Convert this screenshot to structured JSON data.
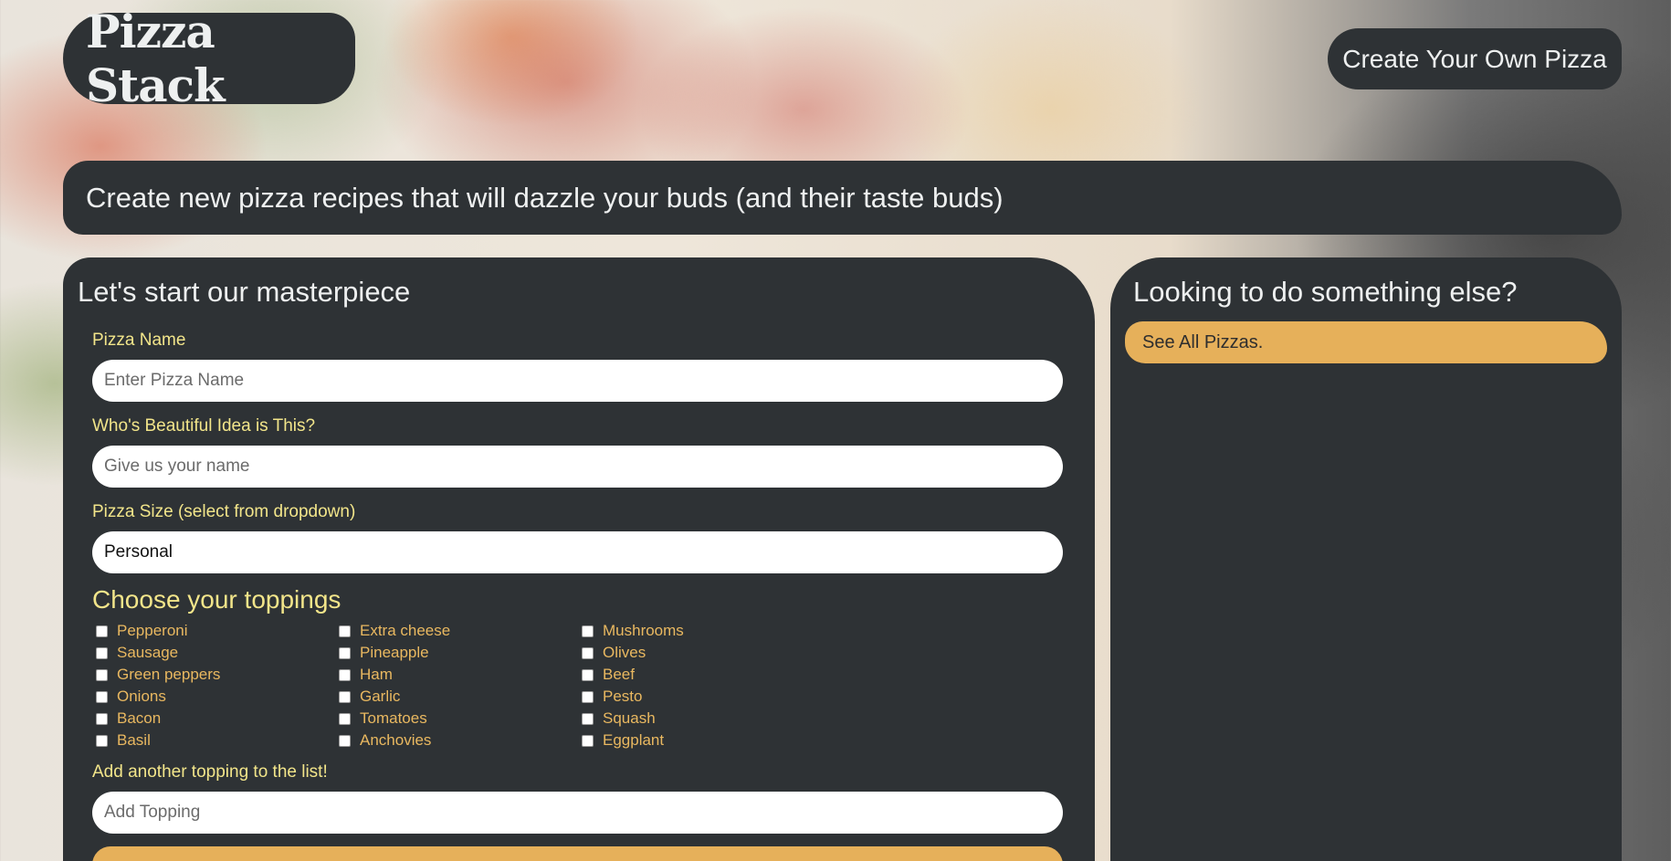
{
  "header": {
    "logo_text": "Pizza Stack",
    "nav_button_label": "Create Your Own Pizza"
  },
  "banner": {
    "text": "Create new pizza recipes that will dazzle your buds (and their taste buds)"
  },
  "create_form": {
    "title": "Let's start our masterpiece",
    "pizza_name_label": "Pizza Name",
    "pizza_name_placeholder": "Enter Pizza Name",
    "author_label": "Who's Beautiful Idea is This?",
    "author_placeholder": "Give us your name",
    "size_label": "Pizza Size (select from dropdown)",
    "size_selected": "Personal",
    "toppings_title": "Choose your toppings",
    "toppings": [
      "Pepperoni",
      "Extra cheese",
      "Mushrooms",
      "Sausage",
      "Pineapple",
      "Olives",
      "Green peppers",
      "Ham",
      "Beef",
      "Onions",
      "Garlic",
      "Pesto",
      "Bacon",
      "Tomatoes",
      "Squash",
      "Basil",
      "Anchovies",
      "Eggplant"
    ],
    "add_topping_label": "Add another topping to the list!",
    "add_topping_placeholder": "Add Topping"
  },
  "sidebar": {
    "title": "Looking to do something else?",
    "see_all_label": "See All Pizzas."
  },
  "colors": {
    "panel_bg": "#2e3235",
    "label_yellow": "#f2e58a",
    "topping_orange": "#e9b860",
    "button_gold": "#e6b05a"
  }
}
